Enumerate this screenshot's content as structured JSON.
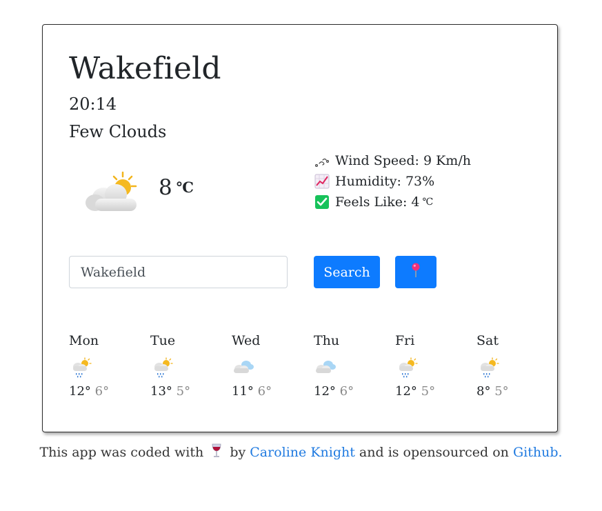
{
  "weather": {
    "city": "Wakefield",
    "time": "20:14",
    "description": "Few Clouds",
    "temperature": "8",
    "temp_unit": "℃",
    "icon": "few-clouds-icon"
  },
  "details": {
    "wind_label": "Wind Speed: 9 Km/h",
    "humidity_label": "Humidity: 73%",
    "feels_like_label": "Feels Like: 4",
    "feels_unit": "℃"
  },
  "search": {
    "value": "Wakefield",
    "button_label": "Search",
    "location_icon": "pushpin-icon"
  },
  "forecast": [
    {
      "day": "Mon",
      "high": "12°",
      "low": "6°",
      "icon": "rain-sun-icon"
    },
    {
      "day": "Tue",
      "high": "13°",
      "low": "5°",
      "icon": "rain-sun-icon"
    },
    {
      "day": "Wed",
      "high": "11°",
      "low": "6°",
      "icon": "clouds-icon"
    },
    {
      "day": "Thu",
      "high": "12°",
      "low": "6°",
      "icon": "clouds-icon"
    },
    {
      "day": "Fri",
      "high": "12°",
      "low": "5°",
      "icon": "rain-sun-icon"
    },
    {
      "day": "Sat",
      "high": "8°",
      "low": "5°",
      "icon": "rain-sun-icon"
    }
  ],
  "footer": {
    "prefix": "This app was coded with",
    "by": "by",
    "author": "Caroline Knight",
    "middle": "and is opensourced on",
    "link": "Github."
  },
  "colors": {
    "accent": "#0d7bff",
    "link": "#1f7ae0"
  }
}
